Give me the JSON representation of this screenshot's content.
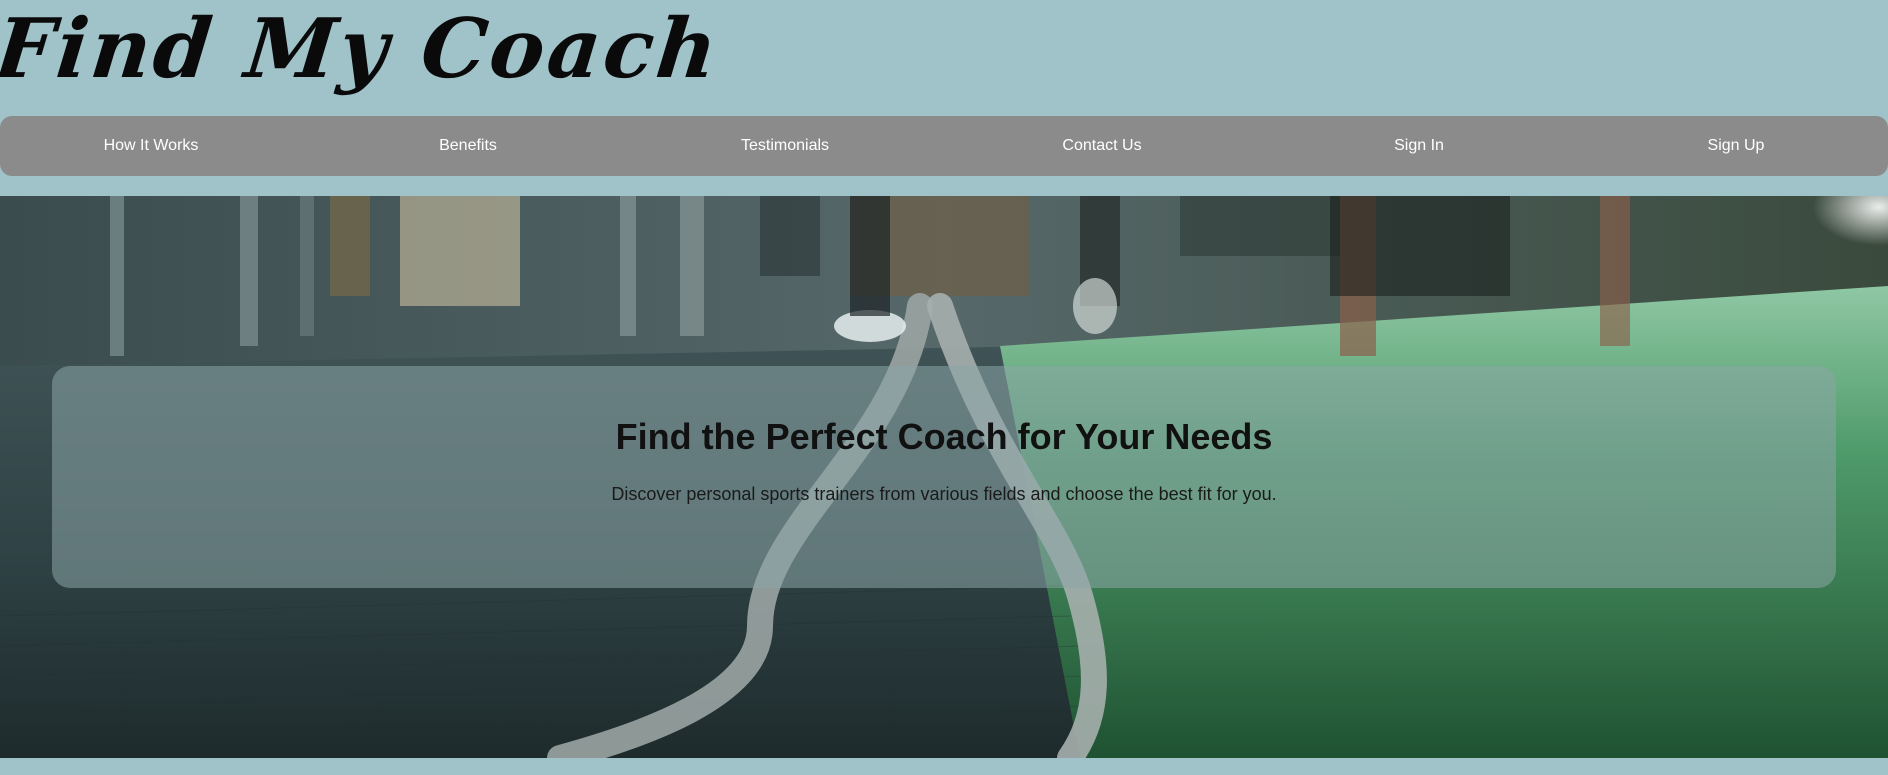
{
  "header": {
    "brand": "Find My Coach"
  },
  "nav": {
    "items": [
      {
        "label": "How It Works"
      },
      {
        "label": "Benefits"
      },
      {
        "label": "Testimonials"
      },
      {
        "label": "Contact Us"
      },
      {
        "label": "Sign In"
      },
      {
        "label": "Sign Up"
      }
    ]
  },
  "hero": {
    "title": "Find the Perfect Coach for Your Needs",
    "subtitle": "Discover personal sports trainers from various fields and choose the best fit for you."
  },
  "colors": {
    "page_background": "#a0c2c9",
    "nav_background": "#8b8b8b",
    "nav_text": "#ffffff",
    "turf_green": "#2d6b45"
  }
}
